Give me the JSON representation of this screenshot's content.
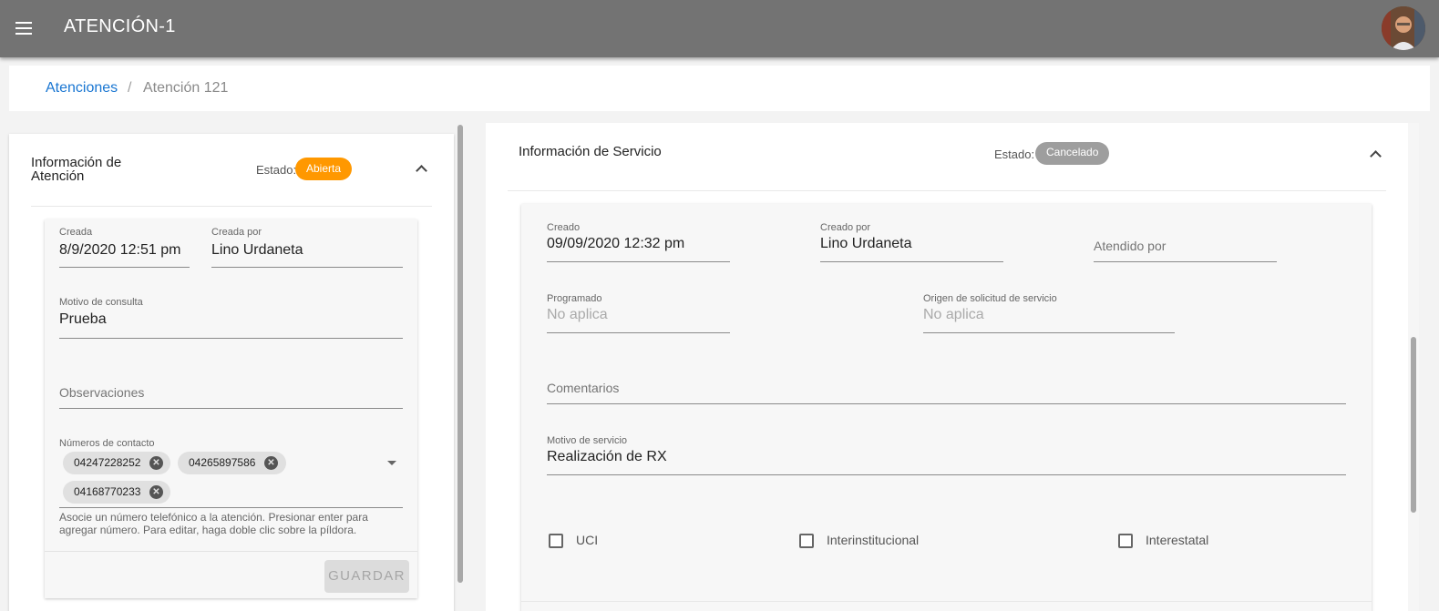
{
  "app": {
    "title": "ATENCIÓN-1"
  },
  "breadcrumb": {
    "parent": "Atenciones",
    "separator": "/",
    "current": "Atención 121"
  },
  "atencion": {
    "title": "Información de Atención",
    "estado_label": "Estado:",
    "estado_value": "Abierta",
    "estado_color": "#ff9800",
    "creada_label": "Creada",
    "creada_value": "8/9/2020 12:51 pm",
    "creada_por_label": "Creada por",
    "creada_por_value": "Lino Urdaneta",
    "motivo_label": "Motivo de consulta",
    "motivo_value": "Prueba",
    "observaciones_placeholder": "Observaciones",
    "contactos_label": "Números de contacto",
    "contactos": [
      "04247228252",
      "04265897586",
      "04168770233"
    ],
    "contactos_hint": "Asocie un número telefónico a la atención. Presionar enter para agregar número. Para editar, haga doble clic sobre la píldora.",
    "guardar_label": "GUARDAR"
  },
  "servicio": {
    "title": "Información de Servicio",
    "estado_label": "Estado:",
    "estado_value": "Cancelado",
    "estado_color": "#9e9e9e",
    "creado_label": "Creado",
    "creado_value": "09/09/2020 12:32 pm",
    "creado_por_label": "Creado por",
    "creado_por_value": "Lino Urdaneta",
    "atendido_por_placeholder": "Atendido por",
    "programado_label": "Programado",
    "programado_value": "No aplica",
    "origen_label": "Origen de solicitud de servicio",
    "origen_value": "No aplica",
    "comentarios_placeholder": "Comentarios",
    "motivo_label": "Motivo de servicio",
    "motivo_value": "Realización de RX",
    "checkboxes": [
      {
        "label": "UCI",
        "checked": false
      },
      {
        "label": "Interinstitucional",
        "checked": false
      },
      {
        "label": "Interestatal",
        "checked": false
      }
    ]
  },
  "icons": {
    "menu": "menu-icon",
    "avatar": "user-avatar",
    "collapse": "chevron-up-icon",
    "chip_remove": "cancel-circle-icon",
    "dropdown": "arrow-drop-down-icon"
  }
}
